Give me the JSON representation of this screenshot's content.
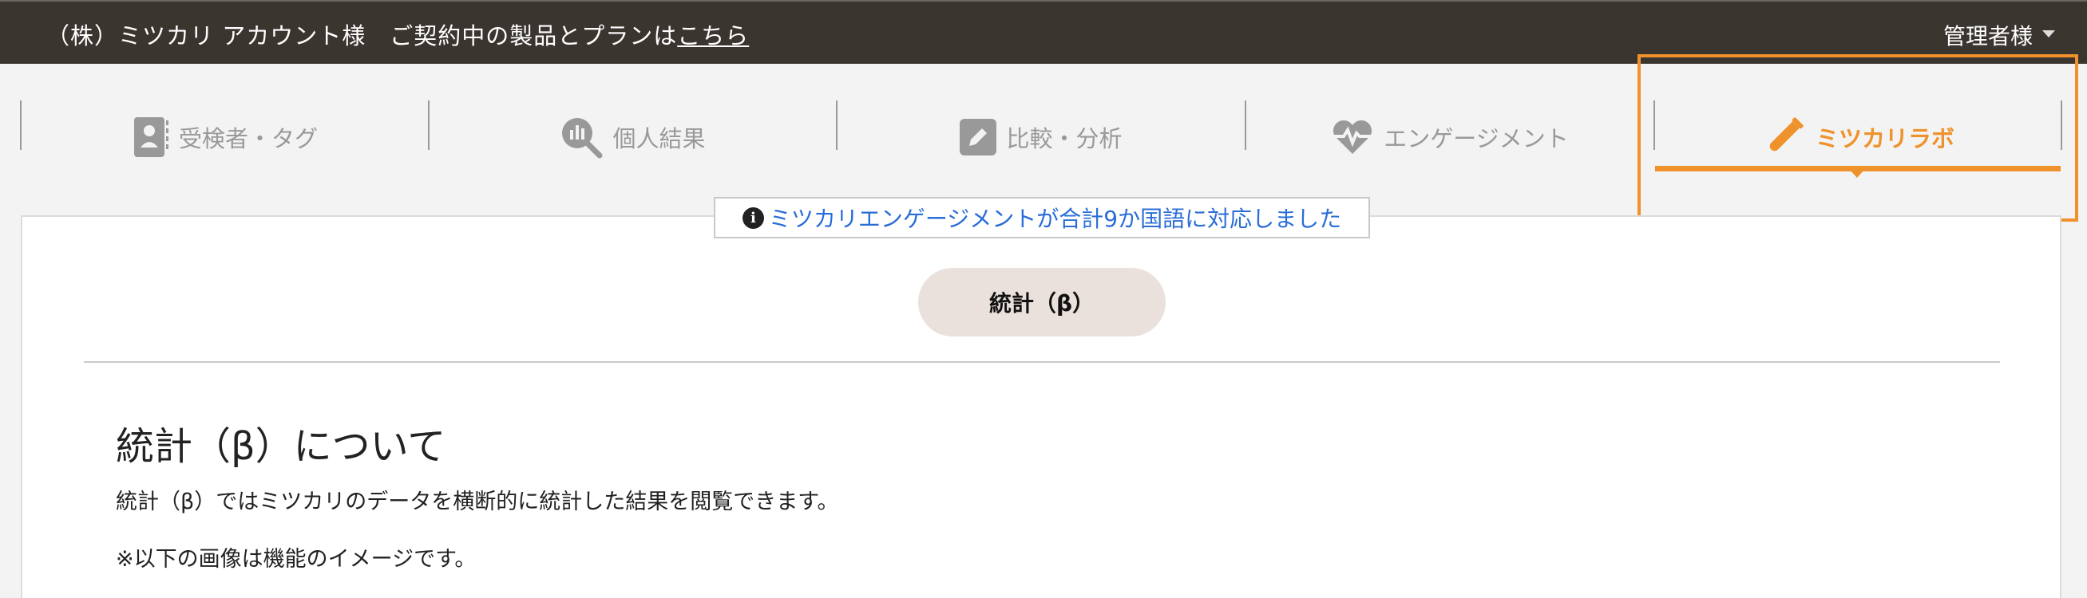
{
  "header": {
    "account_name": "（株）ミツカリ アカウント様　ご契約中の製品とプランは",
    "plan_link": "こちら",
    "admin_label": "管理者様"
  },
  "tabs": [
    {
      "label": "受検者・タグ",
      "icon": "user-badge-icon"
    },
    {
      "label": "個人結果",
      "icon": "chart-search-icon"
    },
    {
      "label": "比較・分析",
      "icon": "pencil-square-icon"
    },
    {
      "label": "エンゲージメント",
      "icon": "heart-pulse-icon"
    },
    {
      "label": "ミツカリラボ",
      "icon": "test-tube-icon",
      "active": true
    }
  ],
  "notice": {
    "text": "ミツカリエンゲージメントが合計9か国語に対応しました"
  },
  "stat_button": {
    "label": "統計（β）"
  },
  "section": {
    "title": "統計（β）について",
    "description": "統計（β）ではミツカリのデータを横断的に統計した結果を閲覧できます。",
    "note": "※以下の画像は機能のイメージです。"
  },
  "colors": {
    "accent": "#f0922b",
    "topbar": "#3b3530",
    "link": "#2a6dd8",
    "button_bg": "#ebe1dc"
  }
}
